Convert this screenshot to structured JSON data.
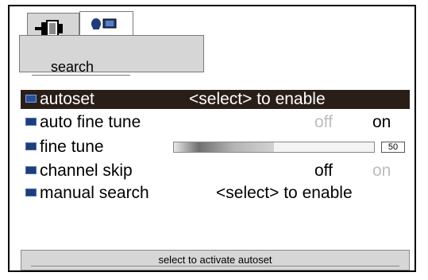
{
  "tabs": {
    "active_tab_label": "search",
    "tab1_icon": "plug-connector-icon",
    "tab2_icon": "antenna-tv-icon"
  },
  "menu": [
    {
      "label": "autoset",
      "value": "<select> to enable",
      "selected": true
    },
    {
      "label": "auto fine tune",
      "options": [
        "off",
        "on"
      ],
      "active": "on"
    },
    {
      "label": "fine tune",
      "slider_value": "50",
      "slider_fraction": 0.5
    },
    {
      "label": "channel skip",
      "options": [
        "off",
        "on"
      ],
      "active": "off"
    },
    {
      "label": "manual search",
      "value": "<select> to enable",
      "selected": false
    }
  ],
  "status": {
    "text": "select to activate autoset"
  },
  "colors": {
    "highlight": "#2a1f18",
    "icon": "#1f3d7a",
    "dim_text": "#bdbdbd"
  }
}
